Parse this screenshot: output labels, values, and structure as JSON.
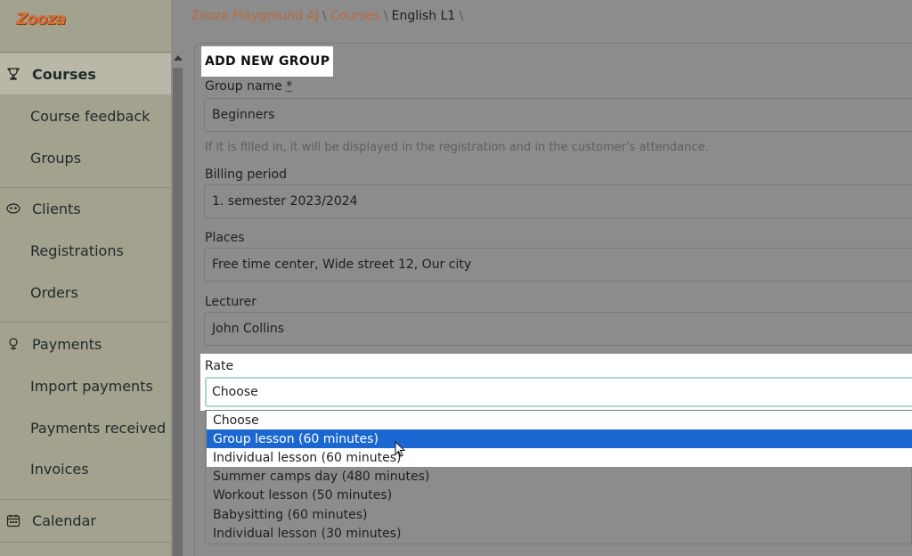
{
  "brand": {
    "logo_text": "Zooza",
    "accent": "#d4703a"
  },
  "breadcrumb": {
    "items": [
      "Zooza Playground AJ",
      "Courses",
      "English L1"
    ],
    "separator": "\\"
  },
  "sidebar": {
    "sections": [
      {
        "label": "Courses",
        "icon": "trophy-icon",
        "active": true,
        "items": [
          "Course feedback",
          "Groups"
        ]
      },
      {
        "label": "Clients",
        "icon": "mask-icon",
        "items": [
          "Registrations",
          "Orders"
        ]
      },
      {
        "label": "Payments",
        "icon": "coin-icon",
        "items": [
          "Import payments",
          "Payments received",
          "Invoices"
        ]
      },
      {
        "label": "Calendar",
        "icon": "calendar-icon",
        "items": []
      }
    ]
  },
  "form": {
    "title": "ADD NEW GROUP",
    "group_name": {
      "label": "Group name",
      "required_mark": "*",
      "value": "Beginners",
      "hint": "If it is filled in, it will be displayed in the registration and in the customer's attendance."
    },
    "billing_period": {
      "label": "Billing period",
      "value": "1. semester 2023/2024"
    },
    "places": {
      "label": "Places",
      "value": "Free time center, Wide street 12, Our city"
    },
    "lecturer": {
      "label": "Lecturer",
      "value": "John Collins"
    },
    "rate": {
      "label": "Rate",
      "value": "Choose",
      "options": [
        "Choose",
        "Group lesson (60 minutes)",
        "Individual lesson (60 minutes)",
        "Summer camps day (480 minutes)",
        "Workout lesson (50 minutes)",
        "Babysitting (60 minutes)",
        "Individual lesson (30 minutes)"
      ],
      "highlighted_option": "Group lesson (60 minutes)"
    }
  },
  "colors": {
    "selected_option": "#1a67d2",
    "link": "#b86a3c",
    "sidebar": "#a3a28f"
  }
}
